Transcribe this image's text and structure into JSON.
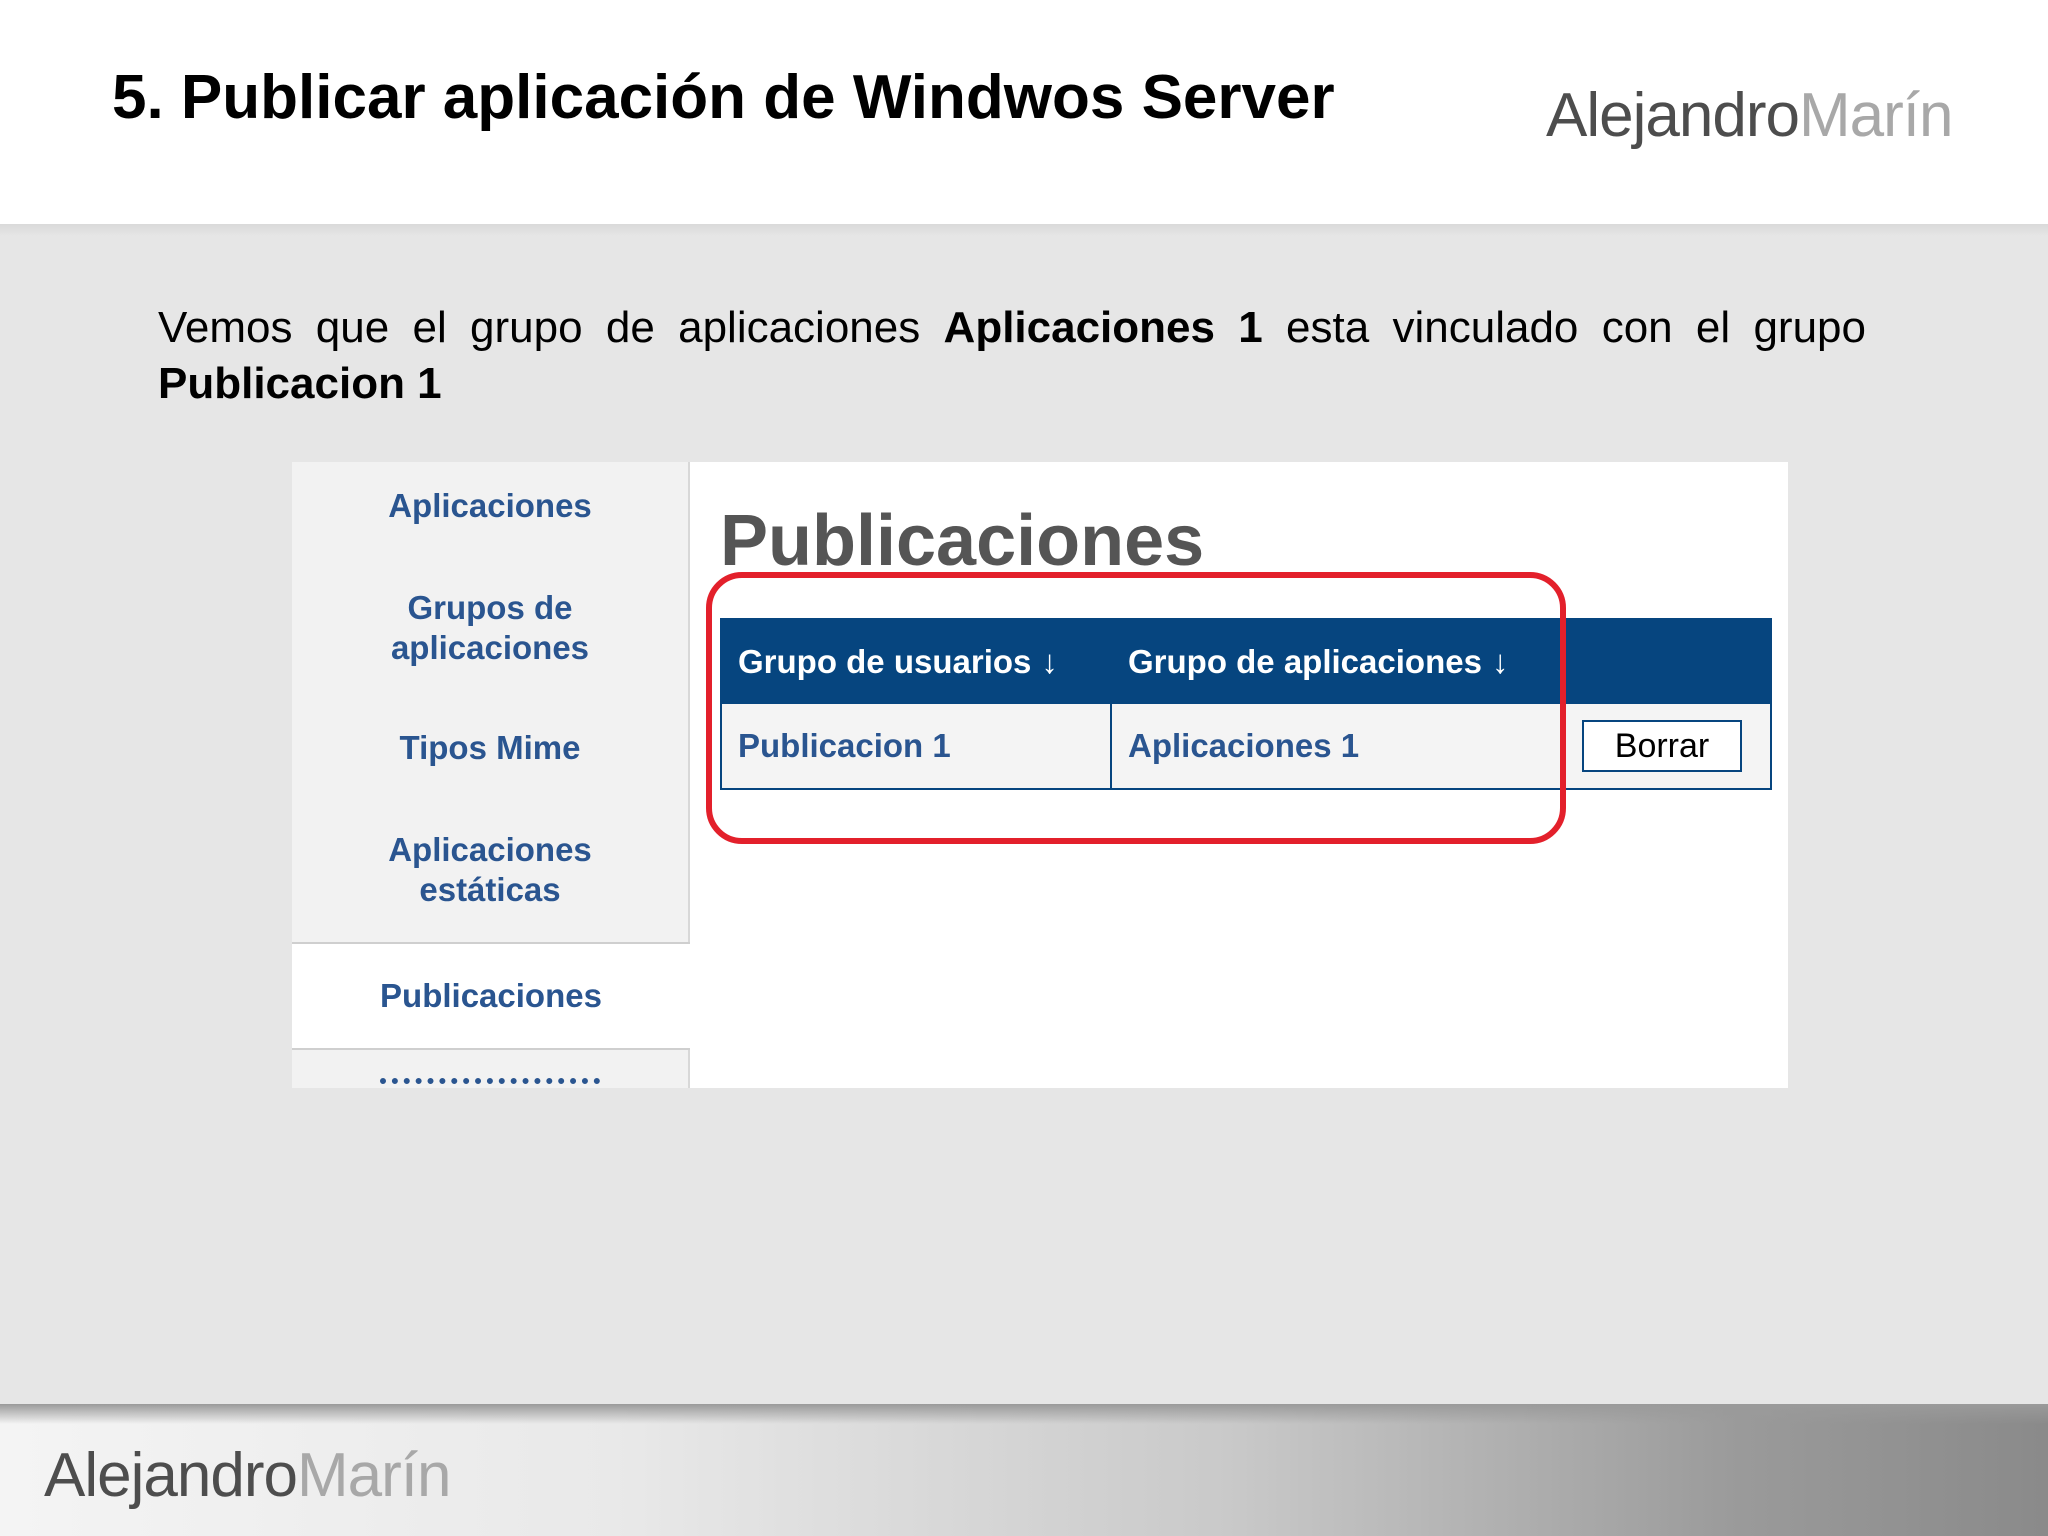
{
  "slide": {
    "title": "5. Publicar aplicación de Windwos Server",
    "logo_first": "Alejandro",
    "logo_last": "Marín",
    "intro": {
      "text1": "Vemos que el grupo de aplicaciones ",
      "bold1": "Aplicaciones 1",
      "text2": " esta vinculado con el grupo ",
      "bold2": "Publicacion 1"
    }
  },
  "sidebar": {
    "items": [
      {
        "line1": "Aplicaciones",
        "line2": ""
      },
      {
        "line1": "Grupos de",
        "line2": "aplicaciones"
      },
      {
        "line1": "Tipos Mime",
        "line2": ""
      },
      {
        "line1": "Aplicaciones",
        "line2": "estáticas"
      },
      {
        "line1": "Publicaciones",
        "line2": ""
      }
    ],
    "active_index": 4
  },
  "main": {
    "title": "Publicaciones",
    "table": {
      "headers": [
        "Grupo de usuarios",
        "Grupo de aplicaciones"
      ],
      "sort_icon": "↓",
      "rows": [
        {
          "user_group": "Publicacion 1",
          "app_group": "Aplicaciones 1",
          "action": "Borrar"
        }
      ]
    }
  },
  "colors": {
    "accent": "#06457f",
    "link": "#2a5590",
    "highlight": "#e3202b"
  }
}
